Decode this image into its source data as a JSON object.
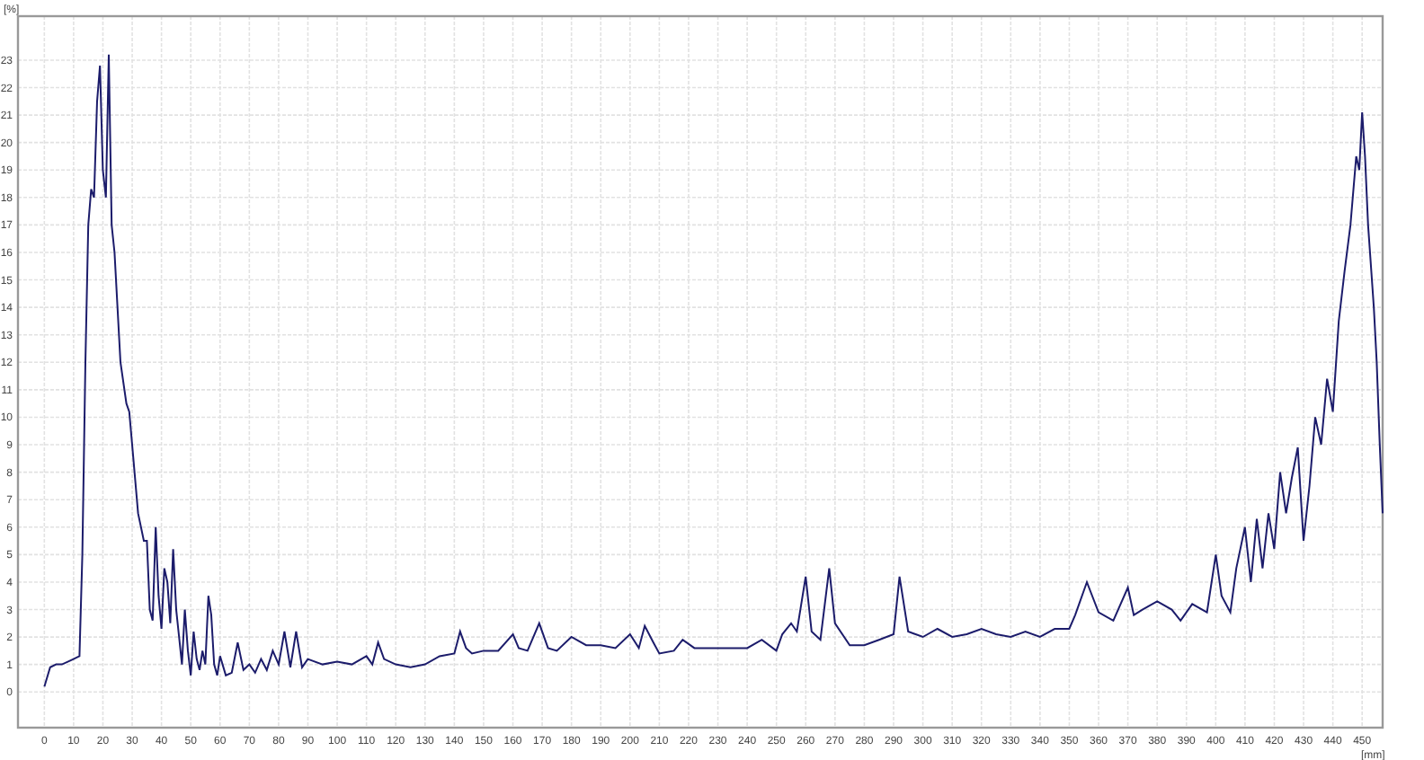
{
  "chart": {
    "chart_data": {
      "type": "line",
      "grid": true,
      "xlabel": "[mm]",
      "ylabel": "[%]",
      "xlim": [
        -9,
        457
      ],
      "ylim": [
        -1.3,
        24.6
      ],
      "xticks": [
        0,
        10,
        20,
        30,
        40,
        50,
        60,
        70,
        80,
        90,
        100,
        110,
        120,
        130,
        140,
        150,
        160,
        170,
        180,
        190,
        200,
        210,
        220,
        230,
        240,
        250,
        260,
        270,
        280,
        290,
        300,
        310,
        320,
        330,
        340,
        350,
        360,
        370,
        380,
        390,
        400,
        410,
        420,
        430,
        440,
        450
      ],
      "yticks": [
        0,
        1,
        2,
        3,
        4,
        5,
        6,
        7,
        8,
        9,
        10,
        11,
        12,
        13,
        14,
        15,
        16,
        17,
        18,
        19,
        20,
        21,
        22,
        23
      ],
      "x": [
        0,
        2,
        4,
        6,
        8,
        10,
        12,
        13,
        14,
        15,
        16,
        17,
        18,
        19,
        20,
        21,
        22,
        23,
        24,
        26,
        28,
        29,
        30,
        32,
        34,
        35,
        36,
        37,
        38,
        39,
        40,
        41,
        42,
        43,
        44,
        45,
        46,
        47,
        48,
        49,
        50,
        51,
        52,
        53,
        54,
        55,
        56,
        57,
        58,
        59,
        60,
        62,
        64,
        66,
        68,
        70,
        72,
        74,
        76,
        78,
        80,
        82,
        84,
        86,
        88,
        90,
        95,
        100,
        105,
        110,
        112,
        114,
        116,
        120,
        125,
        130,
        135,
        140,
        142,
        144,
        146,
        150,
        155,
        160,
        162,
        165,
        169,
        172,
        175,
        180,
        185,
        190,
        195,
        200,
        203,
        205,
        208,
        210,
        215,
        218,
        222,
        230,
        240,
        245,
        250,
        252,
        255,
        257,
        260,
        262,
        265,
        268,
        270,
        275,
        280,
        285,
        290,
        292,
        295,
        300,
        305,
        310,
        315,
        320,
        325,
        330,
        335,
        340,
        345,
        350,
        352,
        356,
        360,
        365,
        370,
        372,
        375,
        380,
        385,
        388,
        392,
        397,
        400,
        402,
        405,
        407,
        410,
        412,
        414,
        416,
        418,
        420,
        422,
        424,
        426,
        428,
        430,
        432,
        434,
        436,
        438,
        440,
        442,
        444,
        446,
        448,
        449,
        450,
        451,
        452,
        454,
        455,
        456,
        457
      ],
      "series": [
        {
          "color": "#1c1c6b",
          "values": [
            0.2,
            0.9,
            1.0,
            1.0,
            1.1,
            1.2,
            1.3,
            5,
            12,
            17,
            18.3,
            18,
            21.5,
            22.8,
            19,
            18,
            23.2,
            17,
            16,
            12,
            10.5,
            10.2,
            9,
            6.5,
            5.5,
            5.5,
            3,
            2.6,
            6,
            3.5,
            2.3,
            4.5,
            4,
            2.5,
            5.2,
            3,
            2,
            1,
            3,
            1.5,
            0.6,
            2.2,
            1.2,
            0.8,
            1.5,
            1,
            3.5,
            2.8,
            1,
            0.6,
            1.3,
            0.6,
            0.7,
            1.8,
            0.8,
            1,
            0.7,
            1.2,
            0.8,
            1.5,
            1.0,
            2.2,
            0.9,
            2.2,
            0.9,
            1.2,
            1.0,
            1.1,
            1.0,
            1.3,
            1.0,
            1.8,
            1.2,
            1.0,
            0.9,
            1.0,
            1.3,
            1.4,
            2.2,
            1.6,
            1.4,
            1.5,
            1.5,
            2.1,
            1.6,
            1.5,
            2.5,
            1.6,
            1.5,
            2,
            1.7,
            1.7,
            1.6,
            2.1,
            1.6,
            2.4,
            1.8,
            1.4,
            1.5,
            1.9,
            1.6,
            1.6,
            1.6,
            1.9,
            1.5,
            2.1,
            2.5,
            2.2,
            4.2,
            2.2,
            1.9,
            4.5,
            2.5,
            1.7,
            1.7,
            1.9,
            2.1,
            4.2,
            2.2,
            2,
            2.3,
            2,
            2.1,
            2.3,
            2.1,
            2,
            2.2,
            2,
            2.3,
            2.3,
            2.8,
            4.0,
            2.9,
            2.6,
            3.8,
            2.8,
            3.0,
            3.3,
            3.0,
            2.6,
            3.2,
            2.9,
            5.0,
            3.5,
            2.9,
            4.5,
            6.0,
            4.0,
            6.3,
            4.5,
            6.5,
            5.2,
            8.0,
            6.5,
            7.8,
            8.9,
            5.5,
            7.5,
            10,
            9.0,
            11.4,
            10.2,
            13.5,
            15.3,
            17,
            19.5,
            19,
            21.1,
            19.5,
            17,
            14,
            12,
            9,
            6.5
          ]
        }
      ]
    }
  }
}
